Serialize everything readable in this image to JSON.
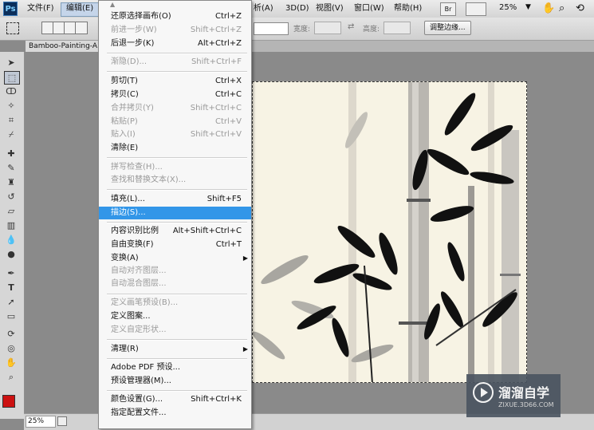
{
  "menubar": {
    "logo": "Ps",
    "items": [
      "文件(F)",
      "编辑(E)",
      "析(A)",
      "3D(D)",
      "视图(V)",
      "窗口(W)",
      "帮助(H)"
    ],
    "zoom": "25%"
  },
  "options": {
    "width_label": "宽度:",
    "height_label": "高度:",
    "refine_button": "调整边缘..."
  },
  "document": {
    "tab_label": "Bamboo-Painting-A",
    "status_zoom": "25%"
  },
  "edit_menu": {
    "items": [
      {
        "label": "还原选择画布(O)",
        "shortcut": "Ctrl+Z",
        "disabled": false
      },
      {
        "label": "前进一步(W)",
        "shortcut": "Shift+Ctrl+Z",
        "disabled": true
      },
      {
        "label": "后退一步(K)",
        "shortcut": "Alt+Ctrl+Z",
        "disabled": false
      },
      {
        "label": "渐隐(D)...",
        "shortcut": "Shift+Ctrl+F",
        "disabled": true
      },
      {
        "label": "剪切(T)",
        "shortcut": "Ctrl+X",
        "disabled": false
      },
      {
        "label": "拷贝(C)",
        "shortcut": "Ctrl+C",
        "disabled": false
      },
      {
        "label": "合并拷贝(Y)",
        "shortcut": "Shift+Ctrl+C",
        "disabled": true
      },
      {
        "label": "粘贴(P)",
        "shortcut": "Ctrl+V",
        "disabled": true
      },
      {
        "label": "贴入(I)",
        "shortcut": "Shift+Ctrl+V",
        "disabled": true
      },
      {
        "label": "清除(E)",
        "shortcut": "",
        "disabled": false
      },
      {
        "label": "拼写检查(H)...",
        "shortcut": "",
        "disabled": true
      },
      {
        "label": "查找和替换文本(X)...",
        "shortcut": "",
        "disabled": true
      },
      {
        "label": "填充(L)...",
        "shortcut": "Shift+F5",
        "disabled": false
      },
      {
        "label": "描边(S)...",
        "shortcut": "",
        "disabled": false
      },
      {
        "label": "内容识别比例",
        "shortcut": "Alt+Shift+Ctrl+C",
        "disabled": false
      },
      {
        "label": "自由变换(F)",
        "shortcut": "Ctrl+T",
        "disabled": false
      },
      {
        "label": "变换(A)",
        "shortcut": "",
        "disabled": false
      },
      {
        "label": "自动对齐图层...",
        "shortcut": "",
        "disabled": true
      },
      {
        "label": "自动混合图层...",
        "shortcut": "",
        "disabled": true
      },
      {
        "label": "定义画笔预设(B)...",
        "shortcut": "",
        "disabled": true
      },
      {
        "label": "定义图案...",
        "shortcut": "",
        "disabled": false
      },
      {
        "label": "定义自定形状...",
        "shortcut": "",
        "disabled": true
      },
      {
        "label": "清理(R)",
        "shortcut": "",
        "disabled": false
      },
      {
        "label": "Adobe PDF 预设...",
        "shortcut": "",
        "disabled": false
      },
      {
        "label": "预设管理器(M)...",
        "shortcut": "",
        "disabled": false
      },
      {
        "label": "颜色设置(G)...",
        "shortcut": "Shift+Ctrl+K",
        "disabled": false
      },
      {
        "label": "指定配置文件...",
        "shortcut": "",
        "disabled": false
      }
    ]
  },
  "watermark": {
    "title": "溜溜自学",
    "url": "ZIXUE.3D66.COM"
  },
  "colors": {
    "highlight": "#3296e8",
    "foreground_swatch": "#cc1111"
  }
}
